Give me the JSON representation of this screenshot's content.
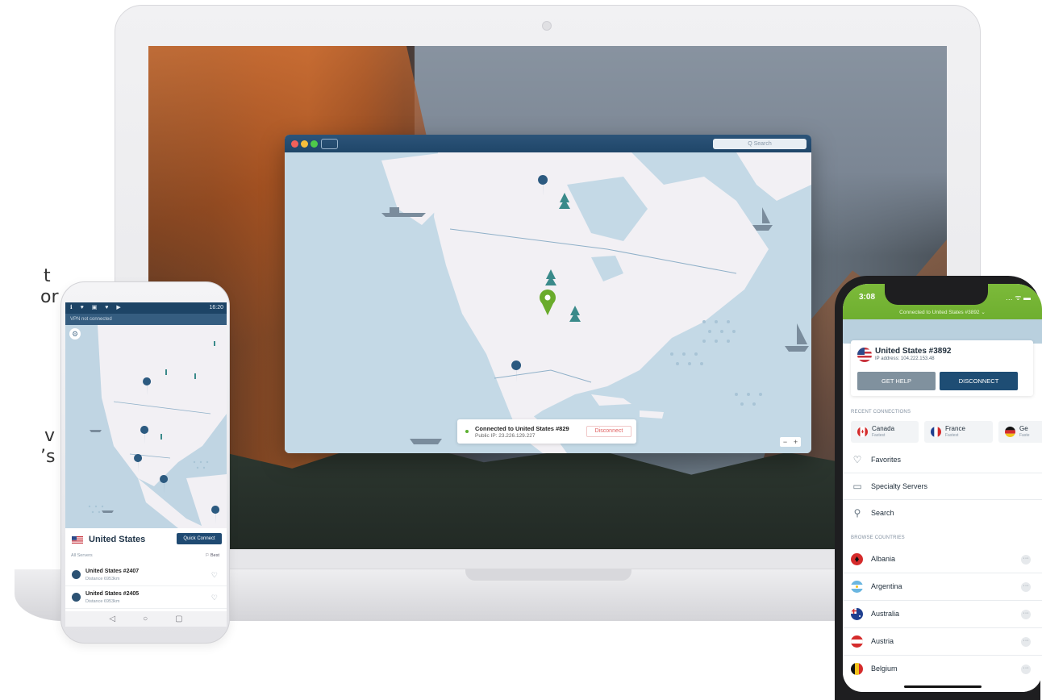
{
  "side_text": [
    "t",
    "or",
    "v",
    "’s"
  ],
  "mac_app": {
    "search_placeholder": "Q Search",
    "status_title": "Connected to United States #829",
    "status_ip": "Public IP: 23.226.129.227",
    "disconnect_label": "Disconnect",
    "zoom_minus": "−",
    "zoom_plus": "+",
    "traffic_colors": [
      "#f2605a",
      "#f7bf3c",
      "#4ecb4a"
    ]
  },
  "android_app": {
    "status_time": "16:20",
    "status_icons": "ℹ ♥ ▣ ♥ ▶",
    "vpn_status": "VPN not connected",
    "country": "United States",
    "quick_connect_label": "Quick Connect",
    "all_servers_label": "All Servers",
    "best_label": "⚐ Best",
    "servers": [
      {
        "name": "United States #2407",
        "distance": "Distance 6953km"
      },
      {
        "name": "United States #2405",
        "distance": "Distance 6953km"
      }
    ],
    "nav_buttons": [
      "◁",
      "○",
      "▢"
    ]
  },
  "ios_app": {
    "time": "3:08",
    "status_icons": "… ᯤ ▬",
    "connected_text": "Connected to United States #3892  ⌄",
    "server": "United States #3892",
    "ip_address": "IP address: 104.222.153.48",
    "get_help_label": "GET HELP",
    "disconnect_label": "DISCONNECT",
    "recent_connections_label": "RECENT CONNECTIONS",
    "recent": [
      {
        "name": "Canada",
        "sub": "Fastest"
      },
      {
        "name": "France",
        "sub": "Fastest"
      },
      {
        "name": "Ge",
        "sub": "Faste"
      }
    ],
    "menu": [
      {
        "label": "Favorites",
        "icon": "heart-icon"
      },
      {
        "label": "Specialty Servers",
        "icon": "folder-icon"
      },
      {
        "label": "Search",
        "icon": "search-icon"
      }
    ],
    "browse_countries_label": "BROWSE COUNTRIES",
    "countries": [
      "Albania",
      "Argentina",
      "Australia",
      "Austria",
      "Belgium"
    ],
    "more_glyph": "···"
  },
  "colors": {
    "accent_green": "#6aab2c",
    "nav_blue": "#1e4d74",
    "map_sea": "#c4d9e6",
    "map_land": "#f2f0f4"
  }
}
